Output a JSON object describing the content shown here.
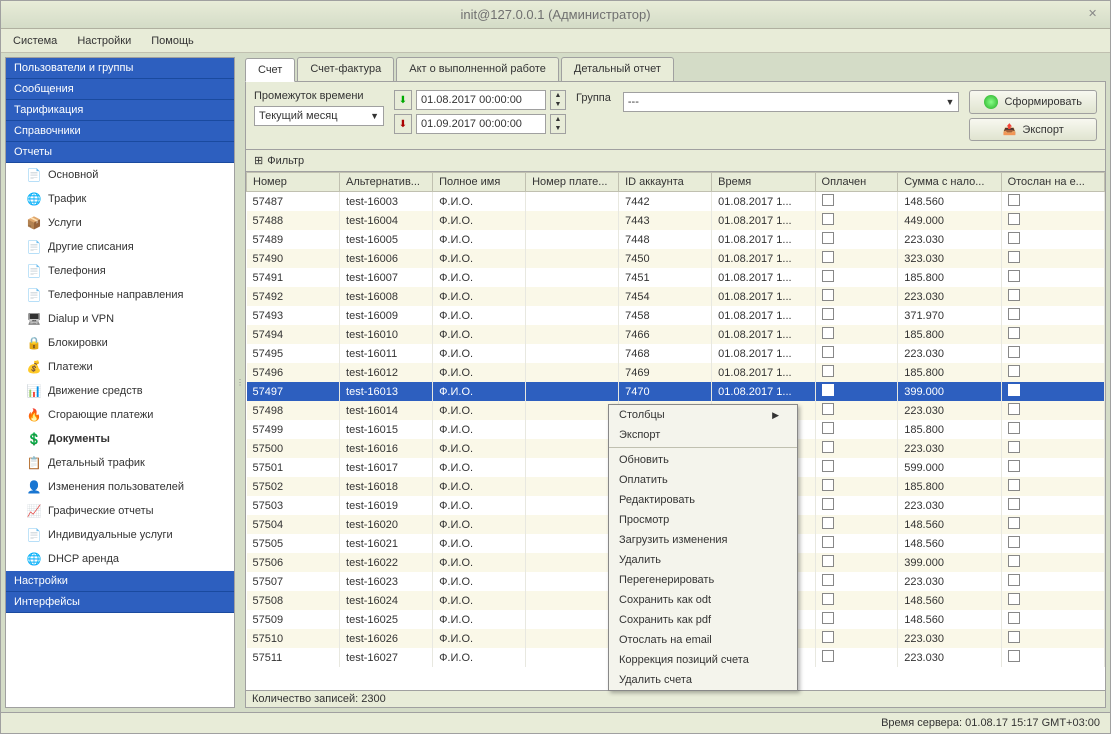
{
  "window": {
    "title": "init@127.0.0.1 (Администратор)"
  },
  "menubar": [
    "Система",
    "Настройки",
    "Помощь"
  ],
  "sidebar": {
    "sections_top": [
      "Пользователи и группы",
      "Сообщения",
      "Тарификация",
      "Справочники"
    ],
    "section_reports": "Отчеты",
    "items": [
      {
        "label": "Основной",
        "icon": "📄"
      },
      {
        "label": "Трафик",
        "icon": "🌐"
      },
      {
        "label": "Услуги",
        "icon": "📦"
      },
      {
        "label": "Другие списания",
        "icon": "📄"
      },
      {
        "label": "Телефония",
        "icon": "📄"
      },
      {
        "label": "Телефонные направления",
        "icon": "📄"
      },
      {
        "label": "Dialup и VPN",
        "icon": "🖥"
      },
      {
        "label": "Блокировки",
        "icon": "🔒"
      },
      {
        "label": "Платежи",
        "icon": "💰"
      },
      {
        "label": "Движение средств",
        "icon": "📊"
      },
      {
        "label": "Сгорающие платежи",
        "icon": "🔥"
      },
      {
        "label": "Документы",
        "icon": "💲",
        "bold": true
      },
      {
        "label": "Детальный трафик",
        "icon": "📋"
      },
      {
        "label": "Изменения пользователей",
        "icon": "👤"
      },
      {
        "label": "Графические отчеты",
        "icon": "📈"
      },
      {
        "label": "Индивидуальные услуги",
        "icon": "📄"
      },
      {
        "label": "DHCP аренда",
        "icon": "🌐"
      }
    ],
    "sections_bottom": [
      "Настройки",
      "Интерфейсы"
    ]
  },
  "tabs": [
    "Счет",
    "Счет-фактура",
    "Акт о выполненной работе",
    "Детальный отчет"
  ],
  "toolbar": {
    "period_label": "Промежуток времени",
    "period_preset": "Текущий месяц",
    "date_from": "01.08.2017 00:00:00",
    "date_to": "01.09.2017 00:00:00",
    "group_label": "Группа",
    "group_value": "---",
    "btn_generate": "Сформировать",
    "btn_export": "Экспорт"
  },
  "filter_label": "Фильтр",
  "table": {
    "columns": [
      "Номер",
      "Альтернатив...",
      "Полное имя",
      "Номер плате...",
      "ID аккаунта",
      "Время",
      "Оплачен",
      "Сумма с нало...",
      "Отослан на е..."
    ],
    "rows": [
      [
        "57487",
        "test-16003",
        "Ф.И.О.",
        "",
        "7442",
        "01.08.2017 1...",
        "",
        "148.560",
        ""
      ],
      [
        "57488",
        "test-16004",
        "Ф.И.О.",
        "",
        "7443",
        "01.08.2017 1...",
        "",
        "449.000",
        ""
      ],
      [
        "57489",
        "test-16005",
        "Ф.И.О.",
        "",
        "7448",
        "01.08.2017 1...",
        "",
        "223.030",
        ""
      ],
      [
        "57490",
        "test-16006",
        "Ф.И.О.",
        "",
        "7450",
        "01.08.2017 1...",
        "",
        "323.030",
        ""
      ],
      [
        "57491",
        "test-16007",
        "Ф.И.О.",
        "",
        "7451",
        "01.08.2017 1...",
        "",
        "185.800",
        ""
      ],
      [
        "57492",
        "test-16008",
        "Ф.И.О.",
        "",
        "7454",
        "01.08.2017 1...",
        "",
        "223.030",
        ""
      ],
      [
        "57493",
        "test-16009",
        "Ф.И.О.",
        "",
        "7458",
        "01.08.2017 1...",
        "",
        "371.970",
        ""
      ],
      [
        "57494",
        "test-16010",
        "Ф.И.О.",
        "",
        "7466",
        "01.08.2017 1...",
        "",
        "185.800",
        ""
      ],
      [
        "57495",
        "test-16011",
        "Ф.И.О.",
        "",
        "7468",
        "01.08.2017 1...",
        "",
        "223.030",
        ""
      ],
      [
        "57496",
        "test-16012",
        "Ф.И.О.",
        "",
        "7469",
        "01.08.2017 1...",
        "",
        "185.800",
        ""
      ],
      [
        "57497",
        "test-16013",
        "Ф.И.О.",
        "",
        "7470",
        "01.08.2017 1...",
        "",
        "399.000",
        ""
      ],
      [
        "57498",
        "test-16014",
        "Ф.И.О.",
        "",
        "",
        "",
        "",
        "223.030",
        ""
      ],
      [
        "57499",
        "test-16015",
        "Ф.И.О.",
        "",
        "",
        "",
        "",
        "185.800",
        ""
      ],
      [
        "57500",
        "test-16016",
        "Ф.И.О.",
        "",
        "",
        "",
        "",
        "223.030",
        ""
      ],
      [
        "57501",
        "test-16017",
        "Ф.И.О.",
        "",
        "",
        "",
        "",
        "599.000",
        ""
      ],
      [
        "57502",
        "test-16018",
        "Ф.И.О.",
        "",
        "",
        "",
        "",
        "185.800",
        ""
      ],
      [
        "57503",
        "test-16019",
        "Ф.И.О.",
        "",
        "",
        "",
        "",
        "223.030",
        ""
      ],
      [
        "57504",
        "test-16020",
        "Ф.И.О.",
        "",
        "",
        "",
        "",
        "148.560",
        ""
      ],
      [
        "57505",
        "test-16021",
        "Ф.И.О.",
        "",
        "",
        "",
        "",
        "148.560",
        ""
      ],
      [
        "57506",
        "test-16022",
        "Ф.И.О.",
        "",
        "",
        "",
        "",
        "399.000",
        ""
      ],
      [
        "57507",
        "test-16023",
        "Ф.И.О.",
        "",
        "",
        "",
        "",
        "223.030",
        ""
      ],
      [
        "57508",
        "test-16024",
        "Ф.И.О.",
        "",
        "",
        "",
        "",
        "148.560",
        ""
      ],
      [
        "57509",
        "test-16025",
        "Ф.И.О.",
        "",
        "",
        "",
        "",
        "148.560",
        ""
      ],
      [
        "57510",
        "test-16026",
        "Ф.И.О.",
        "",
        "",
        "",
        "",
        "223.030",
        ""
      ],
      [
        "57511",
        "test-16027",
        "Ф.И.О.",
        "",
        "",
        "",
        "",
        "223.030",
        ""
      ]
    ],
    "selected_index": 10,
    "record_count": "Количество записей: 2300"
  },
  "context_menu": {
    "items": [
      {
        "label": "Столбцы",
        "submenu": true
      },
      {
        "label": "Экспорт"
      },
      {
        "sep": true
      },
      {
        "label": "Обновить"
      },
      {
        "label": "Оплатить"
      },
      {
        "label": "Редактировать"
      },
      {
        "label": "Просмотр"
      },
      {
        "label": "Загрузить изменения"
      },
      {
        "label": "Удалить"
      },
      {
        "label": "Перегенерировать"
      },
      {
        "label": "Сохранить как odt"
      },
      {
        "label": "Сохранить как pdf"
      },
      {
        "label": "Отослать на email"
      },
      {
        "label": "Коррекция позиций счета"
      },
      {
        "label": "Удалить счета"
      }
    ]
  },
  "statusbar": "Время сервера:  01.08.17 15:17 GMT+03:00"
}
